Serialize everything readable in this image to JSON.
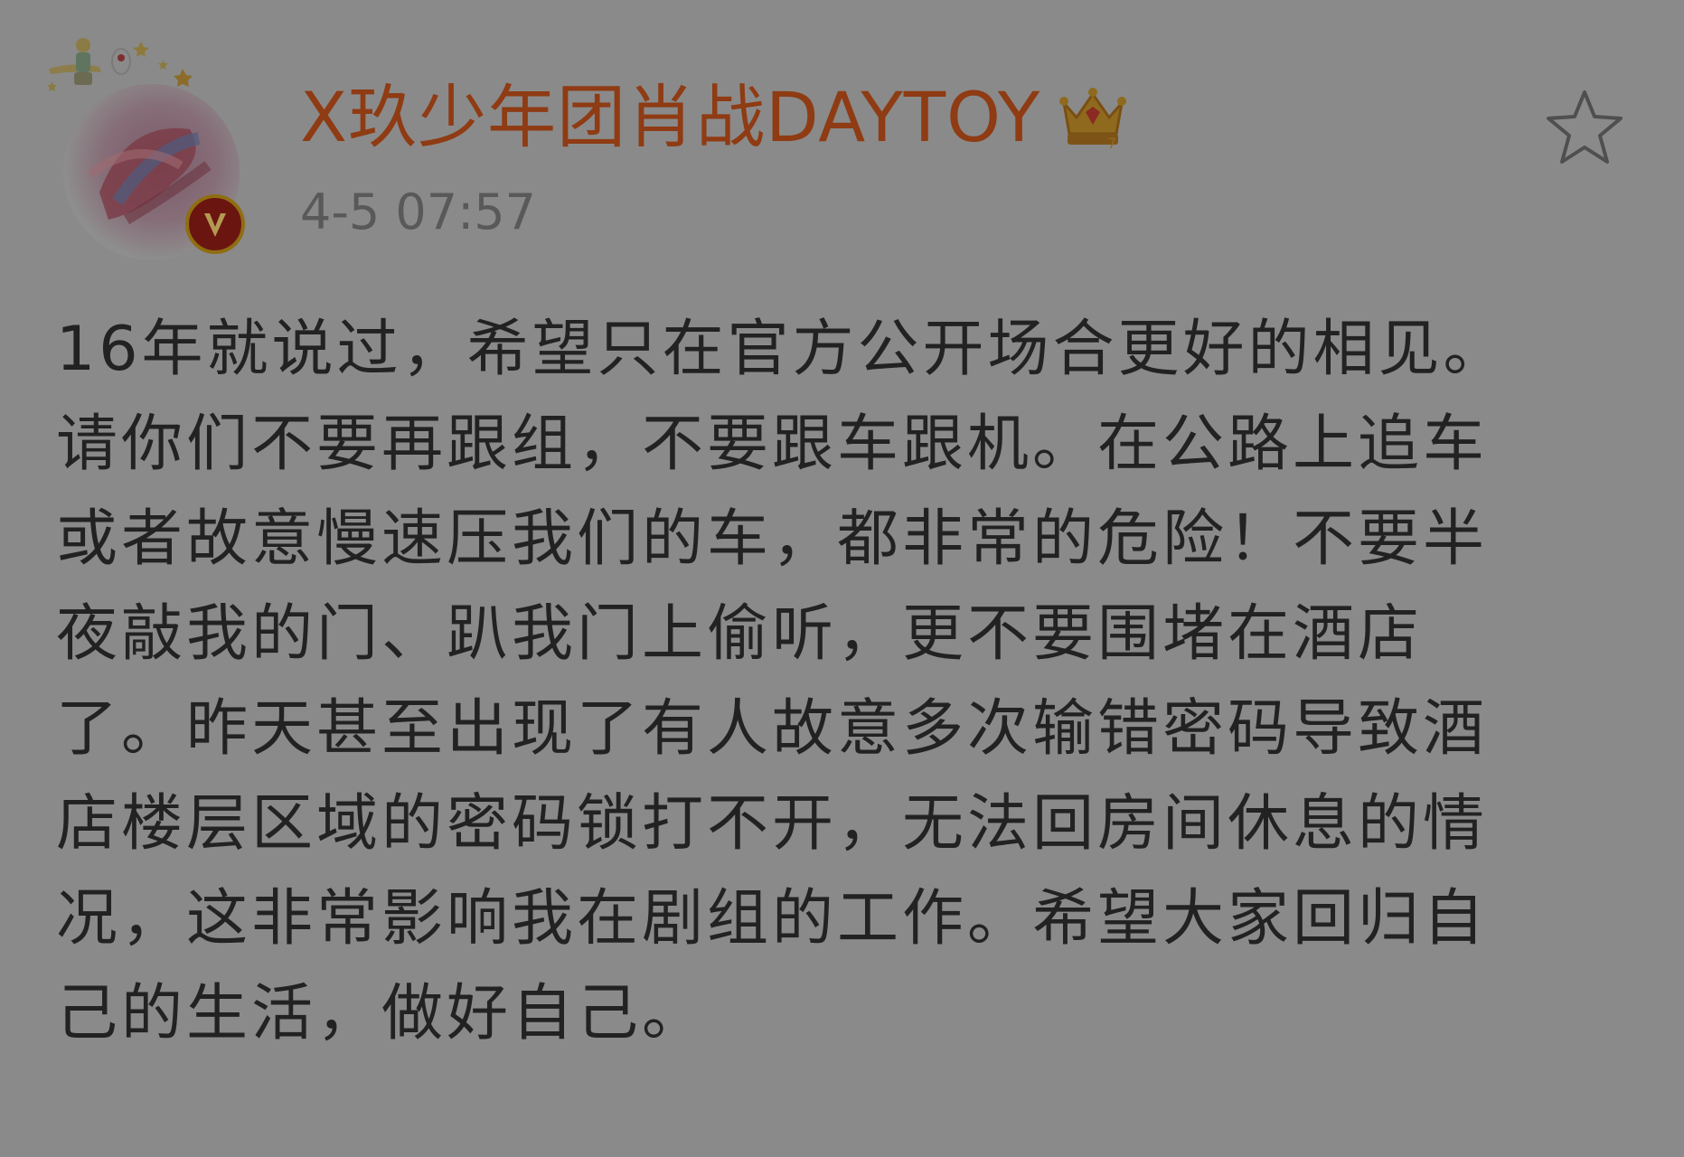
{
  "author": {
    "name": "X玖少年团肖战DAYTOY",
    "badge_icon": "crown-icon",
    "verified_icon": "verified-v-icon"
  },
  "post": {
    "timestamp": "4-5 07:57",
    "favorite_icon": "star-outline-icon",
    "lines": [
      "16年就说过，希望只在官方公开场合更好的相见。",
      "请你们不要再跟组，不要跟车跟机。在公路上追车",
      "或者故意慢速压我们的车，都非常的危险！不要半",
      "夜敲我的门、趴我门上偷听，更不要围堵在酒店",
      "了。昨天甚至出现了有人故意多次输错密码导致酒",
      "店楼层区域的密码锁打不开，无法回房间休息的情",
      "况，这非常影响我在剧组的工作。希望大家回归自",
      "己的生活，做好自己。"
    ]
  },
  "colors": {
    "background": "#8a8a8a",
    "username": "#8f3b13",
    "timestamp": "#595959",
    "body_text": "#222222"
  }
}
